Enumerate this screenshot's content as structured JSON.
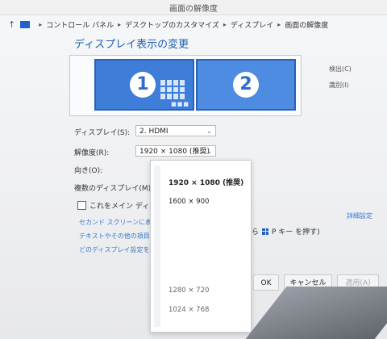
{
  "window": {
    "title": "画面の解像度"
  },
  "breadcrumb": {
    "up_glyph": "↑",
    "items": [
      "コントロール パネル",
      "デスクトップのカスタマイズ",
      "ディスプレイ",
      "画面の解像度"
    ]
  },
  "page": {
    "heading": "ディスプレイ表示の変更"
  },
  "monitors": [
    {
      "number": "1"
    },
    {
      "number": "2"
    }
  ],
  "side_buttons": {
    "detect": "検出(C)",
    "identify": "識別(I)"
  },
  "fields": {
    "display_label": "ディスプレイ(S):",
    "display_value": "2. HDMI",
    "resolution_label": "解像度(R):",
    "resolution_value": "1920 × 1080 (推奨)",
    "orientation_label": "向き(O):",
    "multiple_label": "複数のディスプレイ(M):"
  },
  "checkbox": {
    "label": "これをメイン ディスプレイ"
  },
  "links": [
    "セカンド スクリーンに表示",
    "テキストやその他の項目の",
    "どのディスプレイ設定を選択"
  ],
  "advanced_link": "詳細設定",
  "hint": {
    "prefix": "ら",
    "suffix": "P キー を押す)"
  },
  "resolution_dropdown": {
    "options": [
      {
        "label": "1920 × 1080 (推奨)",
        "selected": true
      },
      {
        "label": "1600 × 900",
        "selected": false
      },
      {
        "label": "1280 × 720",
        "selected": false
      },
      {
        "label": "1024 × 768",
        "selected": false
      }
    ]
  },
  "buttons": {
    "ok": "OK",
    "cancel": "キャンセル",
    "apply": "適用(A)"
  },
  "colors": {
    "accent": "#1d5fb3",
    "monitor": "#3f7ed8",
    "link": "#3a78c9"
  }
}
